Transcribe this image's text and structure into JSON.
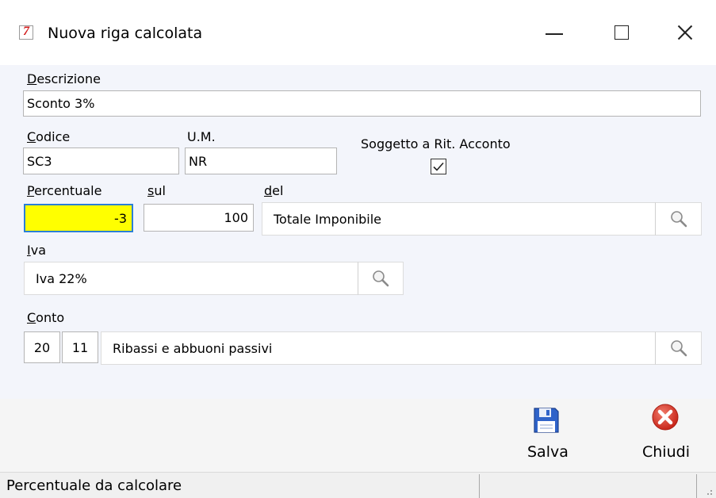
{
  "window": {
    "title": "Nuova riga calcolata",
    "app_icon_glyph": "7"
  },
  "form": {
    "descrizione": {
      "label_accel": "D",
      "label_rest": "escrizione",
      "value": "Sconto 3%"
    },
    "codice": {
      "label_accel": "C",
      "label_rest": "odice",
      "value": "SC3"
    },
    "um": {
      "label": "U.M.",
      "value": "NR"
    },
    "soggetto": {
      "label": "Soggetto a Rit. Acconto",
      "checked": true
    },
    "percentuale": {
      "label_accel": "P",
      "label_rest": "ercentuale",
      "value": "-3"
    },
    "sul": {
      "label_accel": "s",
      "label_rest": "ul",
      "value": "100"
    },
    "del": {
      "label_accel": "d",
      "label_rest": "el",
      "value": "Totale Imponibile"
    },
    "iva": {
      "label_accel": "I",
      "label_rest": "va",
      "value": "Iva 22%"
    },
    "conto": {
      "label_accel": "C",
      "label_rest": "onto",
      "mastro": "20",
      "sottoconto": "11",
      "value": "Ribassi e abbuoni passivi"
    }
  },
  "toolbar": {
    "save_label": "Salva",
    "close_label": "Chiudi"
  },
  "status": {
    "text": "Percentuale da calcolare"
  },
  "colors": {
    "accent_focus": "#2a7fd6",
    "highlight_field": "#ffff00",
    "close_red": "#d9372a",
    "save_blue": "#2f63c9"
  },
  "icons": {
    "lookup": "magnifier-icon",
    "save": "floppy-disk-icon",
    "close": "red-x-circle-icon"
  }
}
